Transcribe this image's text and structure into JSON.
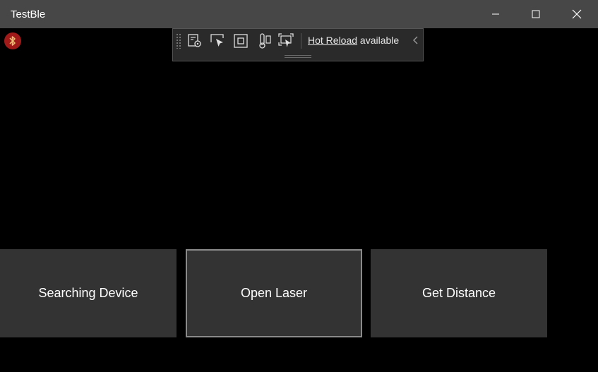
{
  "window": {
    "title": "TestBle"
  },
  "devtools": {
    "tools": [
      "live-visual-tree-icon",
      "select-element-icon",
      "display-layout-adorners-icon",
      "track-focus-icon",
      "preview-selection-icon"
    ],
    "hot_reload_link": "Hot Reload",
    "hot_reload_suffix": " available"
  },
  "buttons": {
    "search": "Searching Device",
    "laser": "Open Laser",
    "distance": "Get Distance"
  }
}
